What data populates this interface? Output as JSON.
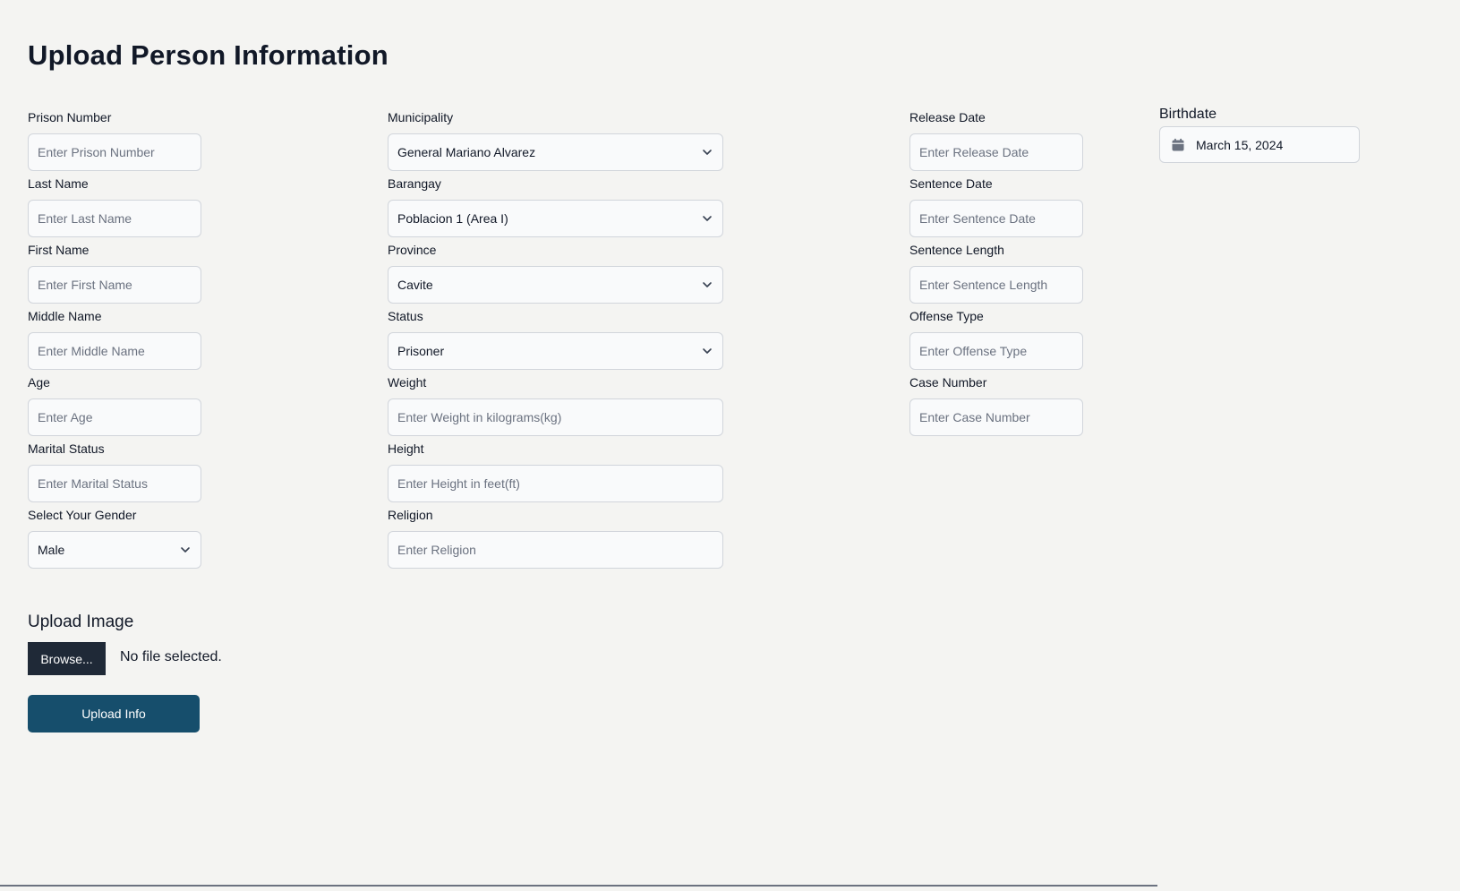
{
  "page": {
    "title": "Upload Person Information"
  },
  "column1": [
    {
      "label": "Prison Number",
      "placeholder": "Enter Prison Number"
    },
    {
      "label": "Last Name",
      "placeholder": "Enter Last Name"
    },
    {
      "label": "First Name",
      "placeholder": "Enter First Name"
    },
    {
      "label": "Middle Name",
      "placeholder": "Enter Middle Name"
    },
    {
      "label": "Age",
      "placeholder": "Enter Age"
    },
    {
      "label": "Marital Status",
      "placeholder": "Enter Marital Status"
    }
  ],
  "gender": {
    "label": "Select Your Gender",
    "value": "Male"
  },
  "column2_selects": [
    {
      "label": "Municipality",
      "value": "General Mariano Alvarez"
    },
    {
      "label": "Barangay",
      "value": "Poblacion 1 (Area I)"
    },
    {
      "label": "Province",
      "value": "Cavite"
    },
    {
      "label": "Status",
      "value": "Prisoner"
    }
  ],
  "column2_inputs": [
    {
      "label": "Weight",
      "placeholder": "Enter Weight in kilograms(kg)"
    },
    {
      "label": "Height",
      "placeholder": "Enter Height in feet(ft)"
    },
    {
      "label": "Religion",
      "placeholder": "Enter Religion"
    }
  ],
  "column3": [
    {
      "label": "Release Date",
      "placeholder": "Enter Release Date"
    },
    {
      "label": "Sentence Date",
      "placeholder": "Enter Sentence Date"
    },
    {
      "label": "Sentence Length",
      "placeholder": "Enter Sentence Length"
    },
    {
      "label": "Offense Type",
      "placeholder": "Enter Offense Type"
    },
    {
      "label": "Case Number",
      "placeholder": "Enter Case Number"
    }
  ],
  "birthdate": {
    "label": "Birthdate",
    "value": "March 15, 2024",
    "icon": "calendar-icon"
  },
  "upload": {
    "heading": "Upload Image",
    "browse_label": "Browse...",
    "file_status": "No file selected.",
    "submit_label": "Upload Info"
  },
  "colors": {
    "background": "#f4f4f2",
    "submit_button": "#164e6c",
    "browse_button": "#1f2937",
    "input_border": "#d1d5db",
    "input_background": "#f9fafb"
  }
}
